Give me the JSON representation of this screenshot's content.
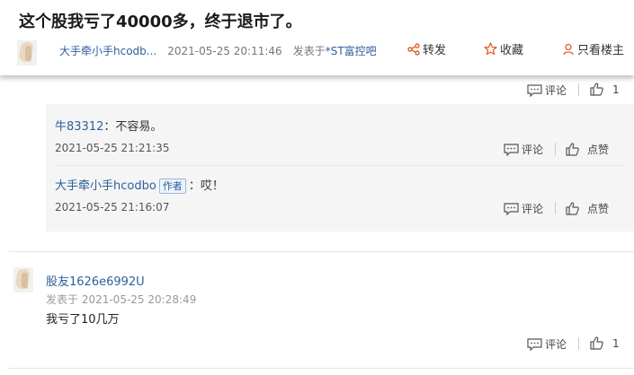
{
  "post": {
    "title": "这个股我亏了40000多，终于退市了。",
    "author": "大手牵小手hcodb...",
    "date": "2021-05-25 20:11:46",
    "posted_in_label": "发表于",
    "forum": "*ST富控吧",
    "share_label": "转发",
    "favorite_label": "收藏",
    "only_author_label": "只看楼主"
  },
  "top_actions": {
    "comment_label": "评论",
    "like_count": "1"
  },
  "replies": [
    {
      "user": "牛83312",
      "colon": "：",
      "text": "不容易。",
      "date": "2021-05-25 21:21:35",
      "comment_label": "评论",
      "like_label": "点赞"
    },
    {
      "user": "大手牵小手hcodbo",
      "badge": "作者",
      "colon": "：",
      "text": "哎！",
      "date": "2021-05-25 21:16:07",
      "comment_label": "评论",
      "like_label": "点赞"
    }
  ],
  "comment": {
    "user": "股友1626e6992U",
    "meta": "发表于 2021-05-25 20:28:49",
    "text": "我亏了10几万",
    "comment_label": "评论",
    "like_count": "1"
  },
  "colors": {
    "link": "#2d5f9b",
    "accent": "#e0622a"
  }
}
